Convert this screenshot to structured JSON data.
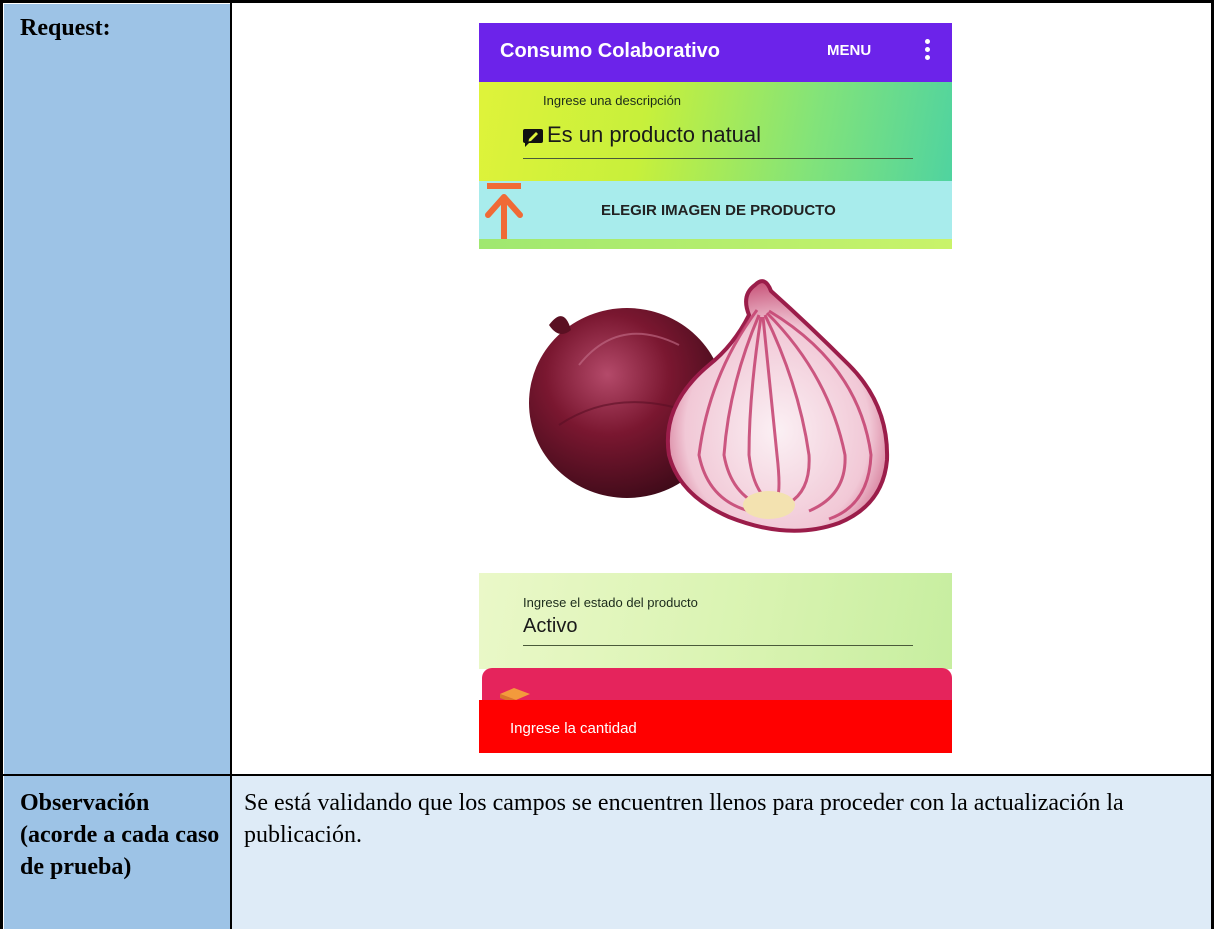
{
  "table": {
    "request_label": "Request:",
    "observation_label": "Observación (acorde a cada caso de prueba)",
    "observation_text": "Se está validando que los campos se encuentren llenos para proceder con la actualización la publicación."
  },
  "app": {
    "title": "Consumo Colaborativo",
    "menu_label": "MENU",
    "overflow_icon": "more-vert-icon",
    "description_field": {
      "hint": "Ingrese una descripción",
      "value": "Es un producto natual",
      "icon": "edit-icon"
    },
    "upload_button": {
      "label": "ELEGIR IMAGEN DE PRODUCTO",
      "icon": "upload-arrow-icon"
    },
    "product_image": "red-onion-image",
    "state_field": {
      "hint": "Ingrese el estado del producto",
      "value": "Activo"
    },
    "toast": "Ingrese la cantidad"
  },
  "colors": {
    "label_column": "#9dc3e6",
    "observation_cell": "#deebf7",
    "app_bar": "#6c23ea",
    "upload_bar": "#a8ecec",
    "upload_arrow": "#f06a36",
    "pink_card": "#e5245c",
    "toast": "#ff0000"
  }
}
